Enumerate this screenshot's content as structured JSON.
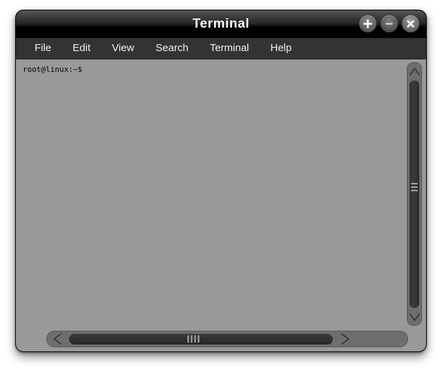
{
  "window": {
    "title": "Terminal",
    "controls": [
      {
        "name": "maximize-button",
        "icon": "plus-icon",
        "label": "+"
      },
      {
        "name": "minimize-button",
        "icon": "minus-icon",
        "label": "−"
      },
      {
        "name": "close-button",
        "icon": "close-icon",
        "label": "×"
      }
    ]
  },
  "menubar": {
    "items": [
      {
        "label": "File"
      },
      {
        "label": "Edit"
      },
      {
        "label": "View"
      },
      {
        "label": "Search"
      },
      {
        "label": "Terminal"
      },
      {
        "label": "Help"
      }
    ]
  },
  "terminal": {
    "prompt": "root@linux:~$",
    "background_color": "#999999",
    "text_color": "#000000"
  },
  "scrollbars": {
    "vertical": {
      "up_arrow_icon": "chevron-up-icon",
      "down_arrow_icon": "chevron-down-icon",
      "grip_lines": 3
    },
    "horizontal": {
      "left_arrow_icon": "chevron-left-icon",
      "right_arrow_icon": "chevron-right-icon",
      "grip_lines": 4
    }
  },
  "colors": {
    "titlebar_top": "#4a4a4a",
    "titlebar_bottom": "#000000",
    "menubar": "#333333",
    "terminal_bg": "#999999",
    "scroll_trough": "#6e6e6e",
    "scroll_thumb": "#333333"
  }
}
